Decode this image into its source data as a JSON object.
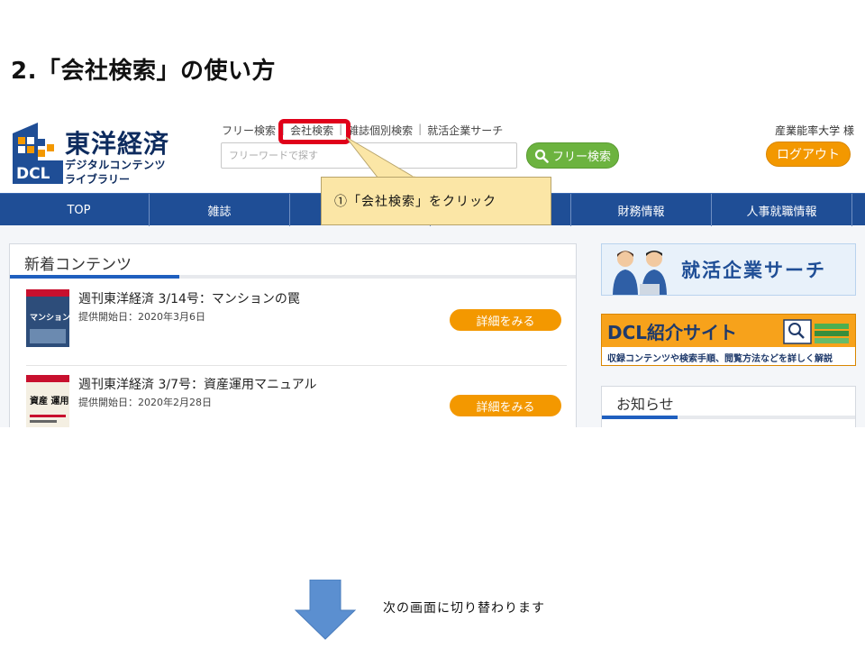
{
  "slide": {
    "title": "2.「会社検索」の使い方"
  },
  "header": {
    "logo_title": "東洋経済",
    "logo_sub1": "デジタルコンテンツ",
    "logo_sub2": "ライブラリー",
    "logo_mark_text": "DCL",
    "top_links": [
      "フリー検索",
      "会社検索",
      "雑誌個別検索",
      "就活企業サーチ"
    ],
    "search_placeholder": "フリーワードで探す",
    "search_button": "フリー検索",
    "user": "産業能率大学 様",
    "logout": "ログアウト"
  },
  "nav": {
    "items": [
      "TOP",
      "雑誌",
      "",
      "",
      "財務情報",
      "人事就職情報"
    ]
  },
  "callout": {
    "text": "①「会社検索」をクリック"
  },
  "new_contents": {
    "heading": "新着コンテンツ",
    "items": [
      {
        "title": "週刊東洋経済 3/14号：マンションの罠",
        "date": "提供開始日：2020年3月6日",
        "button": "詳細をみる",
        "cover_text": "マンション 罠"
      },
      {
        "title": "週刊東洋経済 3/7号：資産運用マニュアル",
        "date": "提供開始日：2020年2月28日",
        "button": "詳細をみる",
        "cover_text": "資産 運用"
      }
    ]
  },
  "side": {
    "job_banner": "就活企業サーチ",
    "dcl_banner_title": "DCL紹介サイト",
    "dcl_banner_sub": "収録コンテンツや検索手順、閲覧方法などを詳しく解説",
    "notice": "お知らせ"
  },
  "footer": {
    "next_text": "次の画面に切り替わります"
  },
  "colors": {
    "nav": "#1f4e96",
    "accent_orange": "#f39800",
    "search_green": "#6cb33f",
    "highlight_red": "#e0001a",
    "callout_bg": "#fbe6a6",
    "arrow": "#5b8fd0"
  }
}
